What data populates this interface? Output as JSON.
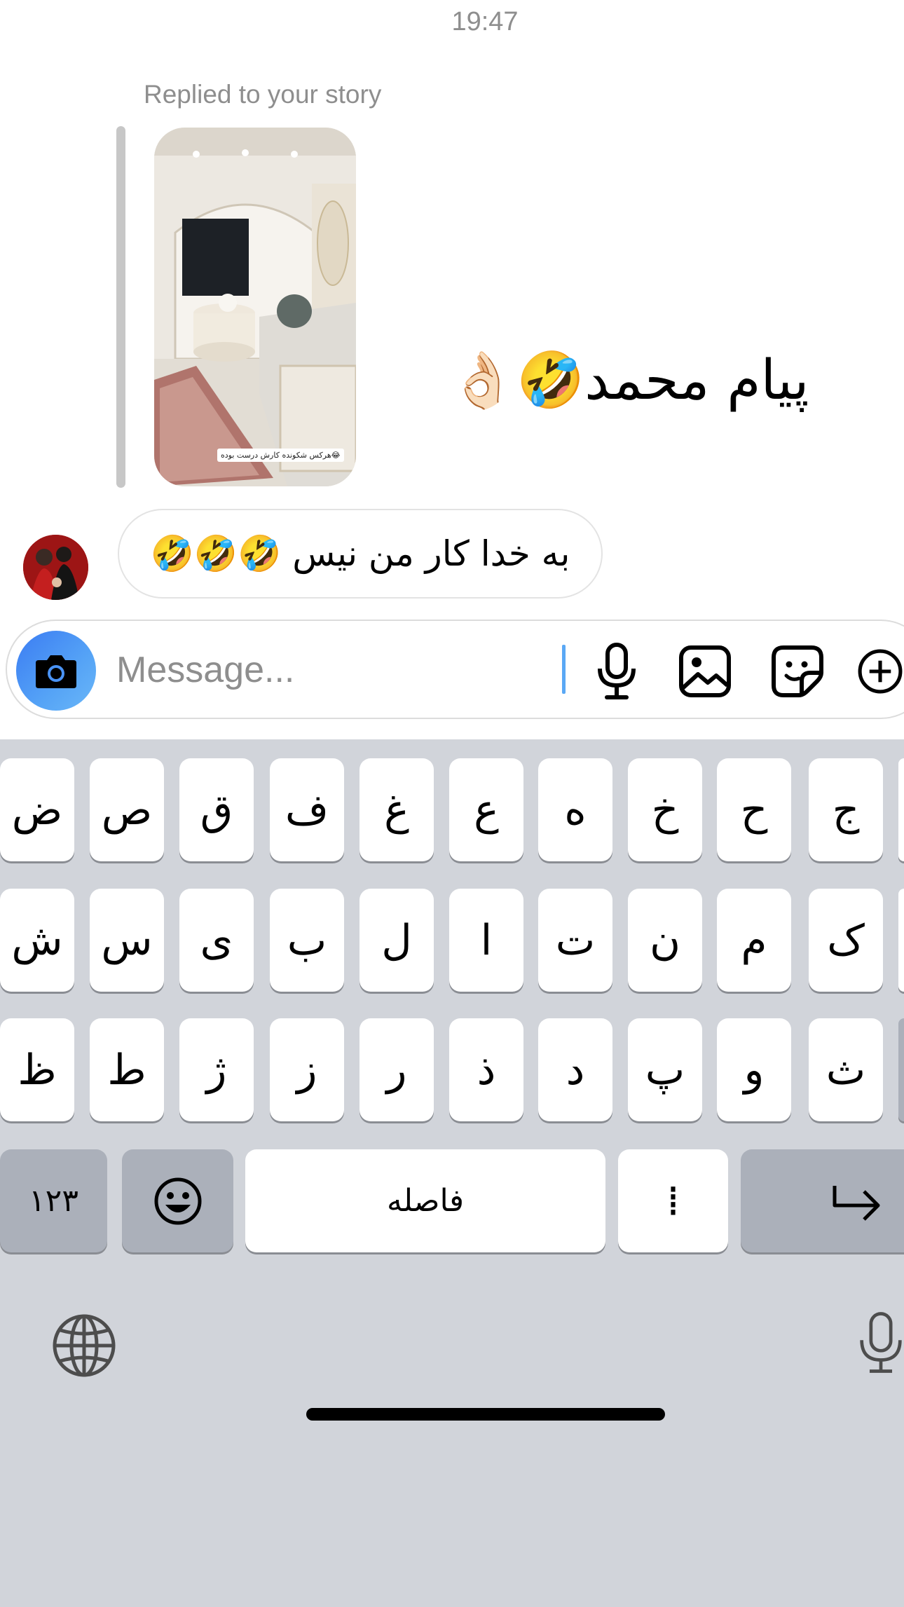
{
  "header": {
    "time": "19:47"
  },
  "thread": {
    "reply_label": "Replied to your story",
    "story_caption": "هرکس شکوندە کارش درست بوده😂",
    "reply_text": "پیام محمد🤣👌🏻",
    "incoming_text": "به خدا کار من نیس 🤣🤣🤣"
  },
  "composer": {
    "placeholder": "Message...",
    "value": "",
    "accent": "#3b7cf3"
  },
  "keyboard": {
    "row1": [
      "ج",
      "ح",
      "خ",
      "ه",
      "ع",
      "غ",
      "ف",
      "ق",
      "ص",
      "ض"
    ],
    "row2": [
      "ک",
      "م",
      "ن",
      "ت",
      "ا",
      "ل",
      "ب",
      "ی",
      "س",
      "ش"
    ],
    "row3": [
      "ث",
      "و",
      "پ",
      "د",
      "ذ",
      "ر",
      "ز",
      "ژ",
      "ط",
      "ظ"
    ],
    "numbers_label": "۱۲۳",
    "space_label": "فاصله",
    "zwnj_label": "⁞"
  },
  "icons": {
    "camera": "camera-icon",
    "mic": "microphone-icon",
    "gallery": "image-icon",
    "sticker": "sticker-icon",
    "add": "plus-circle-icon",
    "emoji": "emoji-icon",
    "return": "return-icon",
    "globe": "globe-icon",
    "dictation": "dictation-mic-icon"
  }
}
